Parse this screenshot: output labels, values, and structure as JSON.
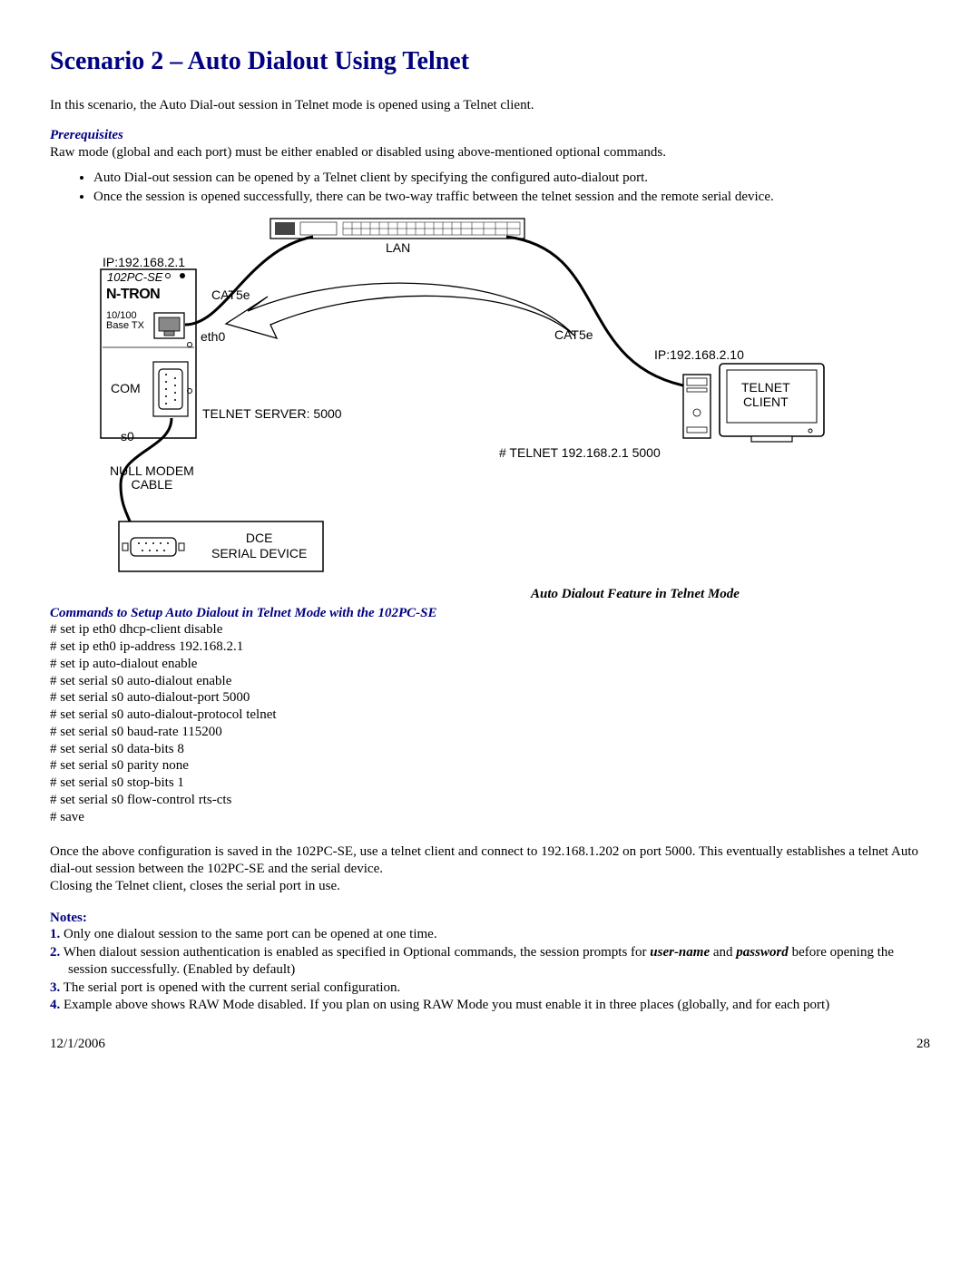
{
  "title": "Scenario 2 – Auto Dialout Using Telnet",
  "intro": "In this scenario, the Auto Dial-out session in Telnet mode is opened using a Telnet client.",
  "prereq": {
    "heading": "Prerequisites",
    "text": "Raw mode (global and each port) must be either enabled or disabled using above-mentioned optional commands.",
    "bullets": [
      "Auto Dial-out session can be opened by a Telnet client by specifying the configured auto-dialout port.",
      "Once the session is opened successfully, there can be two-way traffic between the telnet session and the remote serial device."
    ]
  },
  "diagram": {
    "ip_left": "IP:192.168.2.1",
    "device_model": "102PC-SE",
    "brand": "N-TRON",
    "port_label": "10/100\nBase TX",
    "com": "COM",
    "s0": "s0",
    "eth0": "eth0",
    "cat5e_1": "CAT5e",
    "cat5e_2": "CAT5e",
    "lan": "LAN",
    "telnet_server": "TELNET SERVER: 5000",
    "null_modem": "NULL MODEM\nCABLE",
    "dce": "DCE\nSERIAL DEVICE",
    "ip_right": "IP:192.168.2.10",
    "telnet_client": "TELNET\nCLIENT",
    "telnet_cmd": "# TELNET 192.168.2.1 5000"
  },
  "caption": "Auto Dialout Feature in Telnet Mode",
  "commands": {
    "heading": "Commands to Setup Auto Dialout in Telnet Mode with the 102PC-SE",
    "lines": [
      "# set ip eth0 dhcp-client disable",
      "# set ip eth0 ip-address 192.168.2.1",
      "# set ip auto-dialout enable",
      "# set serial s0 auto-dialout enable",
      "# set serial s0 auto-dialout-port 5000",
      "# set serial s0 auto-dialout-protocol telnet",
      "# set serial s0 baud-rate 115200",
      "# set serial s0 data-bits 8",
      "# set serial s0 parity none",
      "# set serial s0 stop-bits 1",
      "# set serial s0 flow-control rts-cts",
      "# save"
    ]
  },
  "para1": "Once the above configuration is saved in the 102PC-SE, use a telnet client and connect to 192.168.1.202 on port 5000. This eventually establishes a telnet Auto dial-out session between the 102PC-SE and the serial device.",
  "para2": "Closing the Telnet client, closes the serial port in use.",
  "notes": {
    "heading": "Notes:",
    "items": [
      {
        "num": "1.",
        "text": "Only one dialout session to the same port can be opened at one time."
      },
      {
        "num": "2.",
        "pre": "When dialout session authentication is enabled as specified in Optional commands, the session prompts for ",
        "em1": "user-name",
        "mid": " and ",
        "em2": "password",
        "post": " before opening the session successfully. (Enabled by default)"
      },
      {
        "num": "3.",
        "text": "The serial port is opened with the current serial configuration."
      },
      {
        "num": "4.",
        "text": "Example above shows RAW Mode disabled.  If you plan on using RAW Mode you must enable it in three places (globally, and for each port)"
      }
    ]
  },
  "footer": {
    "date": "12/1/2006",
    "page": "28"
  }
}
